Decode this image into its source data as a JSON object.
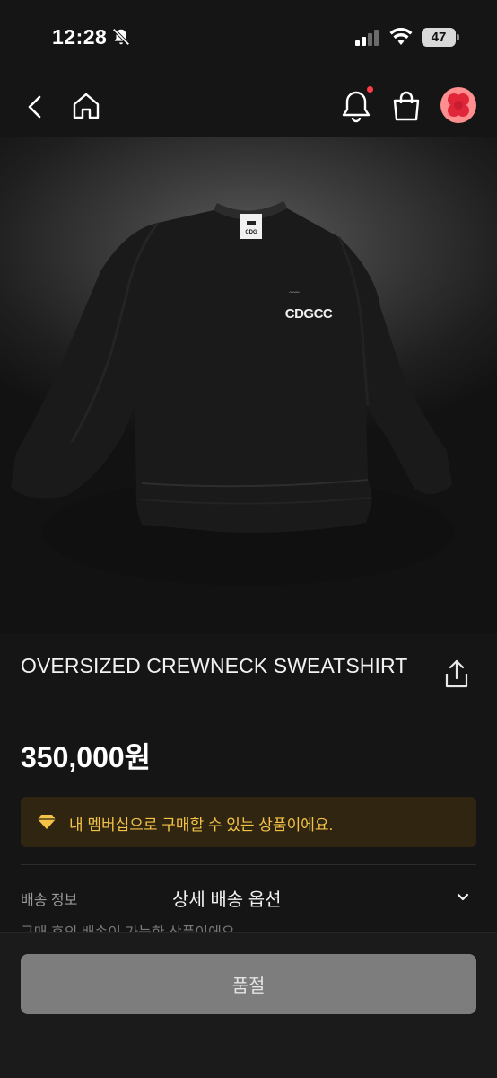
{
  "status_bar": {
    "time": "12:28",
    "battery": "47"
  },
  "product": {
    "title": "OVERSIZED CREWNECK SWEATSHIRT",
    "price": "350,000원",
    "print_small": "CDG",
    "print_chest": "CDGCC"
  },
  "notice": {
    "text": "내 멤버십으로 구매할 수 있는 상품이에요."
  },
  "shipping": {
    "label": "배송 정보",
    "option": "상세 배송 옵션",
    "truncated_text": "구매 후의 배송이 가능한 상품이에요"
  },
  "action": {
    "soldout_label": "품절"
  },
  "colors": {
    "background": "#151515",
    "notice_bg": "#2f2510",
    "notice_text": "#f3c247",
    "button_bg": "#7d7d7d",
    "avatar": "#ff8e8e",
    "alert_dot": "#ff3b47"
  },
  "icons": [
    "bell-off-icon",
    "signal-icon",
    "wifi-icon",
    "back-icon",
    "home-icon",
    "bell-icon",
    "bag-icon",
    "share-icon",
    "gem-icon",
    "chevron-down-icon"
  ]
}
